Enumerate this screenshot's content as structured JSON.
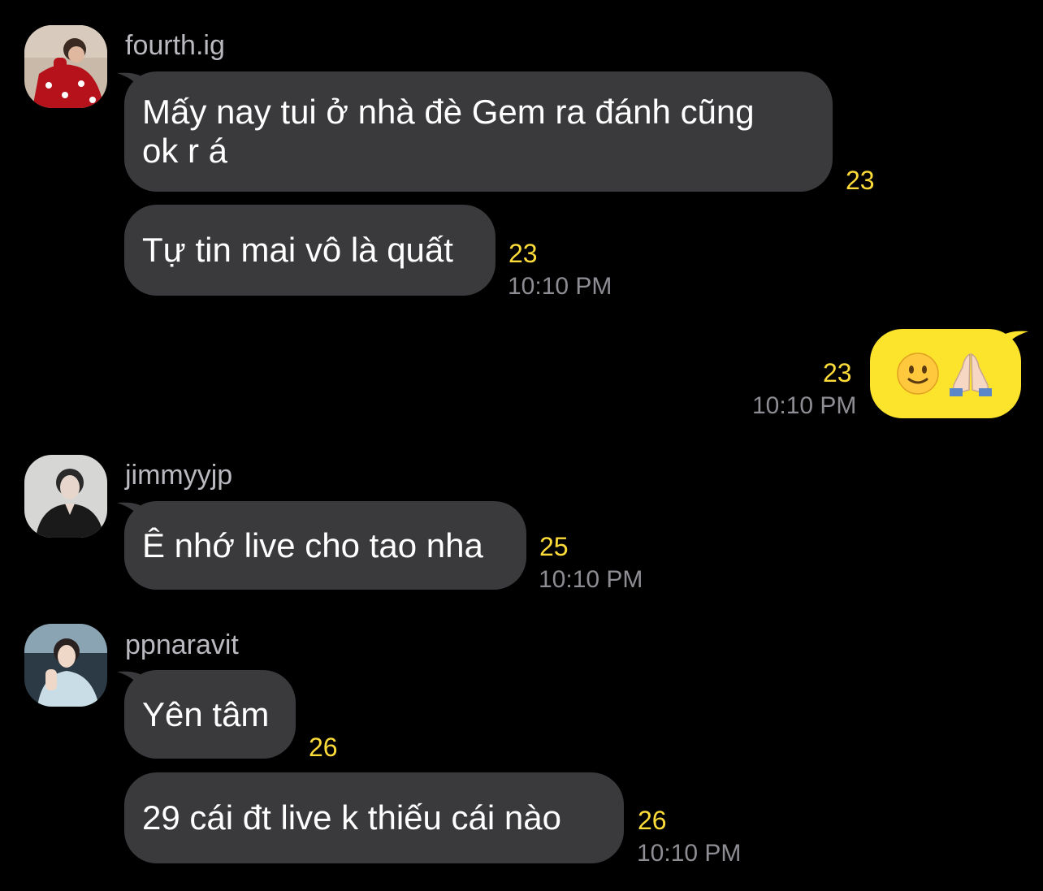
{
  "colors": {
    "background": "#000000",
    "bubble_in": "#3a3a3d",
    "bubble_out": "#fde42c",
    "unread_count": "#fddc3a",
    "timestamp": "#8d8d93",
    "sender_name": "#b9b9bf"
  },
  "messages": {
    "group1": {
      "sender": "fourth.ig",
      "avatar_icon": "profile-photo",
      "m1": {
        "text": "Mấy nay tui ở nhà đè Gem ra đánh cũng\nok r á",
        "count": "23"
      },
      "m2": {
        "text": "Tự tin mai vô là quất",
        "count": "23",
        "time": "10:10 PM"
      }
    },
    "own": {
      "emojis": [
        "slightly-smiling-face-icon",
        "folded-hands-icon"
      ],
      "count": "23",
      "time": "10:10 PM"
    },
    "group2": {
      "sender": "jimmyyjp",
      "avatar_icon": "profile-photo",
      "m1": {
        "text": "Ê nhớ live cho tao nha",
        "count": "25",
        "time": "10:10 PM"
      }
    },
    "group3": {
      "sender": "ppnaravit",
      "avatar_icon": "profile-photo",
      "m1": {
        "text": "Yên tâm",
        "count": "26"
      },
      "m2": {
        "text": "29 cái đt live k thiếu cái nào",
        "count": "26",
        "time": "10:10 PM"
      }
    }
  }
}
